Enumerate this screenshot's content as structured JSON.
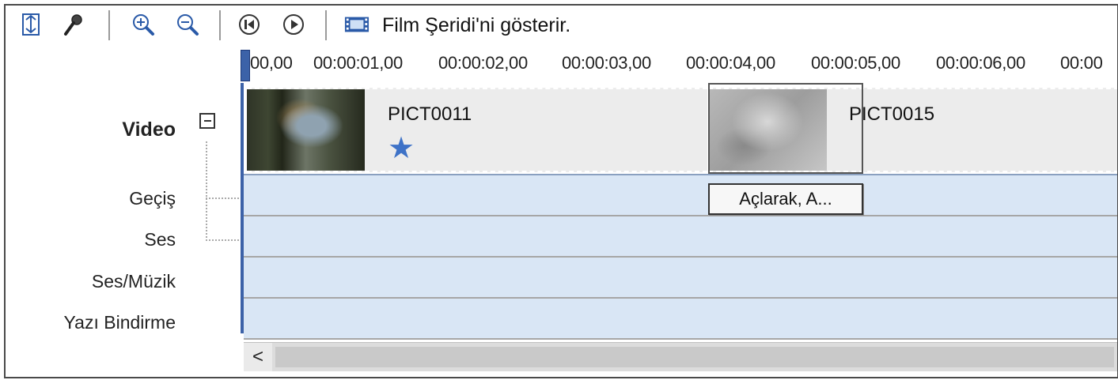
{
  "toolbar": {
    "icons": [
      "storyboard-toggle-icon",
      "narrate-icon",
      "zoom-in-icon",
      "zoom-out-icon",
      "rewind-icon",
      "play-icon",
      "filmstrip-icon"
    ],
    "storyboard_label": "Film Şeridi'ni gösterir."
  },
  "ruler": {
    "ticks": [
      "00,00",
      "00:00:01,00",
      "00:00:02,00",
      "00:00:03,00",
      "00:00:04,00",
      "00:00:05,00",
      "00:00:06,00",
      "00:00"
    ]
  },
  "tracks": {
    "video": "Video",
    "transition": "Geçiş",
    "audio": "Ses",
    "audio_music": "Ses/Müzik",
    "title_overlay": "Yazı Bindirme"
  },
  "clips": {
    "clip1": "PICT0011",
    "clip2": "PICT0015",
    "transition": "Açlarak, A..."
  },
  "scrollbar": {
    "left_arrow": "<"
  },
  "colors": {
    "track_blue": "#d9e6f5",
    "playhead": "#3c62a8",
    "star": "#3e72c7"
  }
}
